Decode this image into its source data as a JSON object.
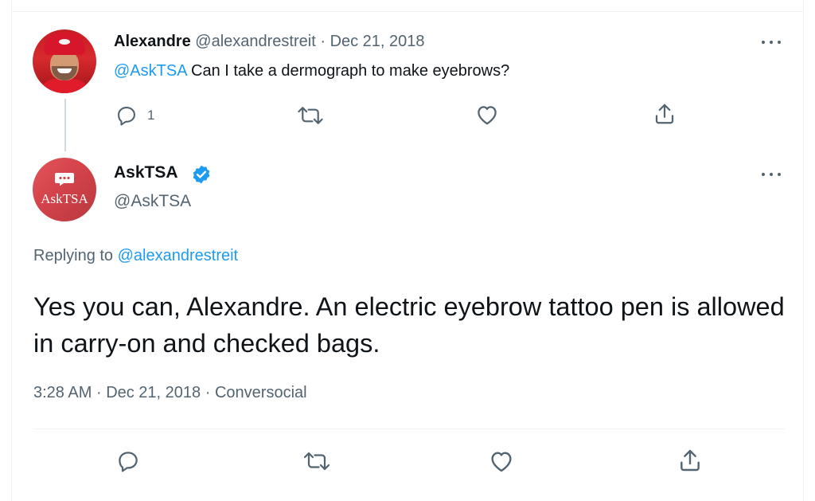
{
  "original_tweet": {
    "author_name": "Alexandre",
    "handle": "@alexandrestreit",
    "separator": "·",
    "date": "Dec 21, 2018",
    "mention": "@AskTSA",
    "text": "Can I take a dermograph to make eyebrows?",
    "reply_count": "1",
    "icons": [
      "reply-icon",
      "retweet-icon",
      "like-icon",
      "share-icon",
      "more-options-icon"
    ]
  },
  "reply_tweet": {
    "author_name": "AskTSA",
    "handle": "@AskTSA",
    "avatar_text": "AskTSA",
    "verified": true,
    "replying_label": "Replying to",
    "replying_handle": "@alexandrestreit",
    "text": "Yes you can, Alexandre. An electric eyebrow tattoo pen is allowed in carry-on and checked bags.",
    "time": "3:28 AM",
    "separator": "·",
    "date": "Dec 21, 2018",
    "source": "Conversocial",
    "icons": [
      "reply-icon",
      "retweet-icon",
      "like-icon",
      "share-icon",
      "more-options-icon"
    ]
  },
  "colors": {
    "accent_blue": "#1d9bf0",
    "muted_text": "#536471",
    "primary_text": "#0f1419",
    "avatar_brand": "#d4424a"
  }
}
